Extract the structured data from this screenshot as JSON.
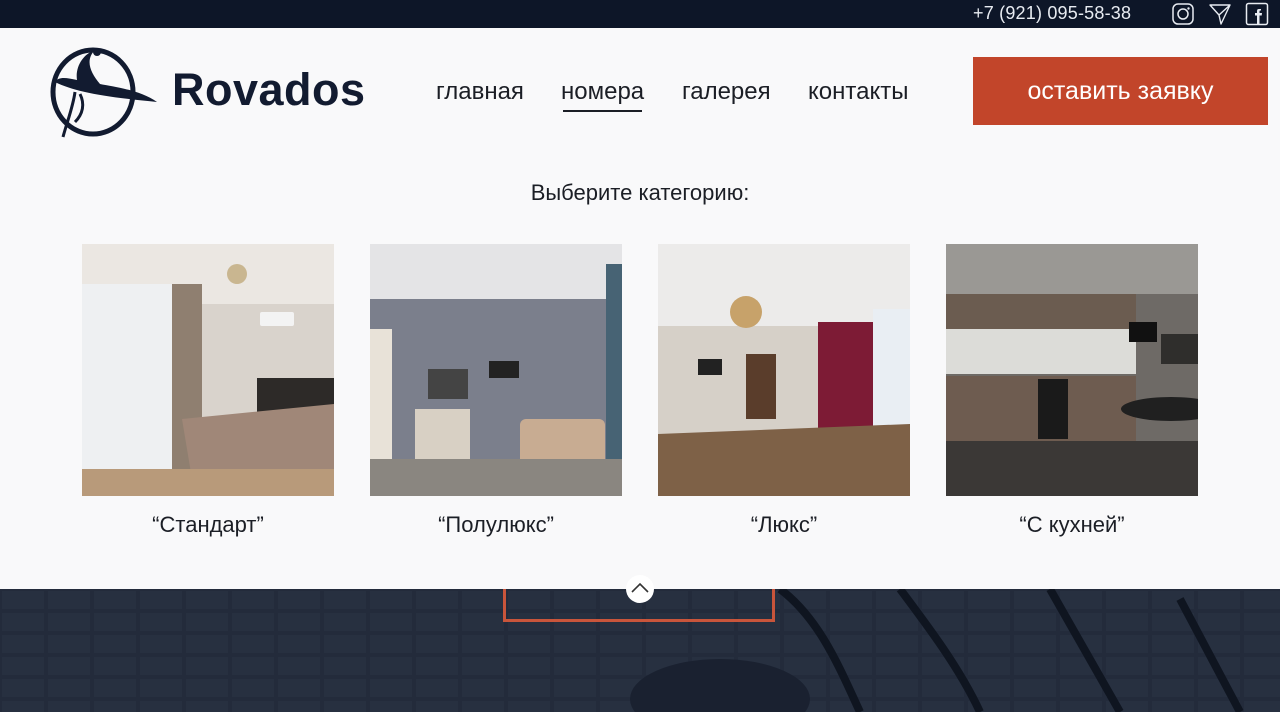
{
  "topbar": {
    "phone": "+7 (921) 095-58-38",
    "social": [
      "instagram-icon",
      "telegram-icon",
      "facebook-icon"
    ]
  },
  "header": {
    "brand": "Rovados",
    "nav": [
      "главная",
      "номера",
      "галерея",
      "контакты"
    ],
    "active_nav": "номера",
    "cta": "оставить заявку"
  },
  "rooms": {
    "heading": "Выберите категорию:",
    "items": [
      {
        "label": "“Стандарт”"
      },
      {
        "label": "“Полулюкс”"
      },
      {
        "label": "“Люкс”"
      },
      {
        "label": "“С кухней”"
      }
    ]
  },
  "colors": {
    "accent": "#c2452a",
    "dark": "#0d1628",
    "panel": "#f9f9fa"
  }
}
